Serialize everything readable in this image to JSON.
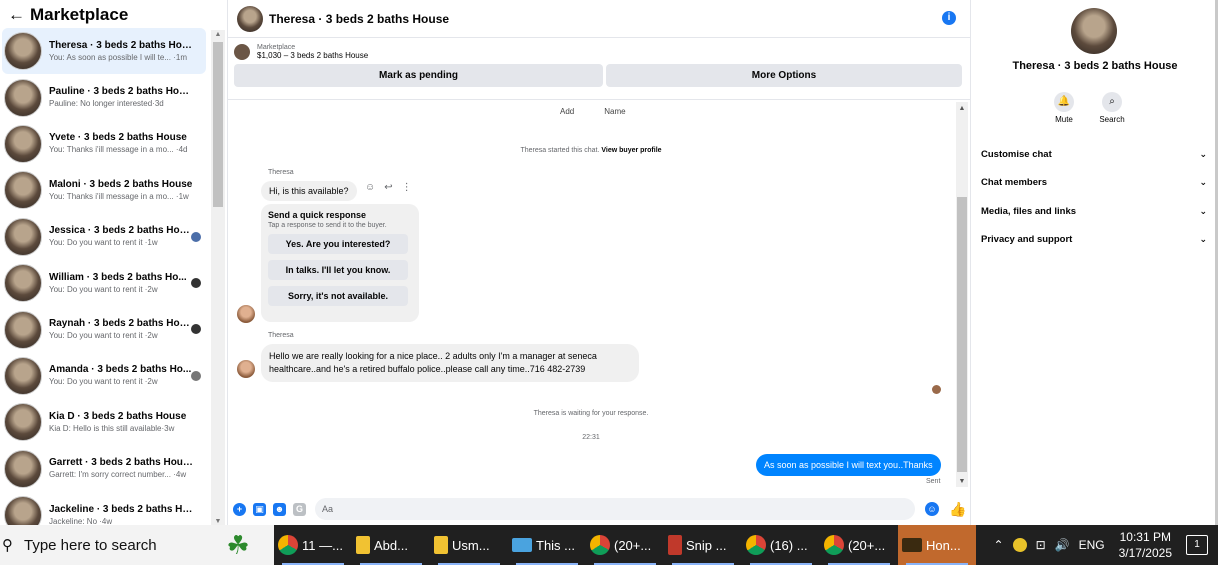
{
  "sidebar": {
    "back_icon": "arrow-left",
    "title": "Marketplace",
    "conversations": [
      {
        "name": "Theresa · 3 beds 2 baths House",
        "preview": "You: As soon as possible I will te... ·1m",
        "active": true,
        "dot": ""
      },
      {
        "name": "Pauline · 3 beds 2 baths House",
        "preview": "Pauline: No longer interested·3d",
        "active": false,
        "dot": ""
      },
      {
        "name": "Yvete · 3 beds 2 baths House",
        "preview": "You: Thanks i'ill message in a mo... ·4d",
        "active": false,
        "dot": ""
      },
      {
        "name": "Maloni · 3 beds 2 baths House",
        "preview": "You: Thanks i'ill message in a mo... ·1w",
        "active": false,
        "dot": ""
      },
      {
        "name": "Jessica · 3 beds 2 baths House",
        "preview": "You: Do you want to rent it ·1w",
        "active": false,
        "dot": "blue"
      },
      {
        "name": "William · 3 beds 2 baths Ho...",
        "preview": "You: Do you want to rent it ·2w",
        "active": false,
        "dot": "dark"
      },
      {
        "name": "Raynah · 3 beds 2 baths Hou...",
        "preview": "You: Do you want to rent it ·2w",
        "active": false,
        "dot": "dark"
      },
      {
        "name": "Amanda · 3 beds 2 baths Ho...",
        "preview": "You: Do you want to rent it ·2w",
        "active": false,
        "dot": "gray"
      },
      {
        "name": "Kia D · 3 beds 2 baths House",
        "preview": "Kia D: Hello is this still available·3w",
        "active": false,
        "dot": ""
      },
      {
        "name": "Garrett · 3 beds 2 baths House",
        "preview": "Garrett: I'm sorry correct number... ·4w",
        "active": false,
        "dot": ""
      },
      {
        "name": "Jackeline · 3 beds 2 baths House",
        "preview": "Jackeline: No ·4w",
        "active": false,
        "dot": ""
      }
    ]
  },
  "chat": {
    "header_title": "Theresa · 3 beds 2 baths House",
    "info_icon": "i",
    "marketplace_label": "Marketplace",
    "listing": "$1,030 – 3 beds 2 baths House",
    "mark_pending": "Mark as pending",
    "more_options": "More Options",
    "add_label": "Add",
    "name_label": "Name",
    "started_prefix": "Theresa started this chat.",
    "view_profile": "View buyer profile",
    "sender1": "Theresa",
    "msg1": "Hi, is this available?",
    "quick_title": "Send a quick response",
    "quick_sub": "Tap a response to send it to the buyer.",
    "quick_options": [
      "Yes. Are you interested?",
      "In talks. I'll let you know.",
      "Sorry, it's not available."
    ],
    "sender2": "Theresa",
    "msg2": "Hello  we are really  looking for a nice place.. 2 adults only I'm a manager  at  seneca healthcare..and he's a retired buffalo police..please call any time..716 482-2739",
    "waiting": "Theresa is waiting for your response.",
    "time": "22:31",
    "outgoing": "As soon as possible I will text you..Thanks",
    "sent": "Sent",
    "composer_placeholder": "Aa"
  },
  "right_panel": {
    "title": "Theresa · 3 beds 2 baths House",
    "mute": "Mute",
    "search": "Search",
    "menu": [
      "Customise chat",
      "Chat members",
      "Media, files and links",
      "Privacy and support"
    ]
  },
  "taskbar": {
    "search_placeholder": "Type here to search",
    "apps": [
      {
        "label": "11 —...",
        "icon": "chrome"
      },
      {
        "label": "Abd...",
        "icon": "folder"
      },
      {
        "label": "Usm...",
        "icon": "folder"
      },
      {
        "label": "This ...",
        "icon": "pc"
      },
      {
        "label": "(20+...",
        "icon": "chrome"
      },
      {
        "label": "Snip ...",
        "icon": "snip"
      },
      {
        "label": "(16) ...",
        "icon": "chrome"
      },
      {
        "label": "(20+...",
        "icon": "chrome"
      },
      {
        "label": "Hon...",
        "icon": "hon"
      }
    ],
    "lang": "ENG",
    "time": "10:31 PM",
    "date": "3/17/2025",
    "notification_count": "1"
  }
}
